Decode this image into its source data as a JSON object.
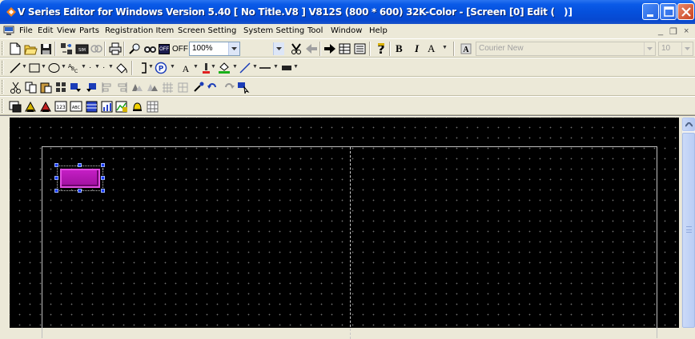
{
  "window": {
    "title": "V Series Editor for Windows Version 5.40 [ No Title.V8 ] V812S (800 * 600) 32K-Color - [Screen [0] Edit (",
    "title_tail": ")]",
    "accent_color": "#0a5ae8"
  },
  "menu": {
    "items": [
      "File",
      "Edit",
      "View",
      "Parts",
      "Registration Item",
      "Screen Setting",
      "System Setting",
      "Tool",
      "Window",
      "Help"
    ],
    "mdi_controls": [
      "_",
      "❐",
      "×"
    ]
  },
  "toolbar1": {
    "off_label": "OFF",
    "off_box_text": "OFF",
    "zoom_value": "100%",
    "bold_label": "B",
    "italic_label": "I",
    "font_a_label": "A",
    "font_box_label": "A",
    "font_name": "Courier New",
    "font_size": "10"
  },
  "toolbar2": {
    "text_tool_label": "A",
    "abc_label": "ABC"
  },
  "toolbar4": {
    "item_labels": [
      "123",
      "ABC"
    ]
  },
  "canvas": {
    "background_color": "#000000",
    "part_color": "#b814b8",
    "handle_color": "#1a3cff"
  }
}
